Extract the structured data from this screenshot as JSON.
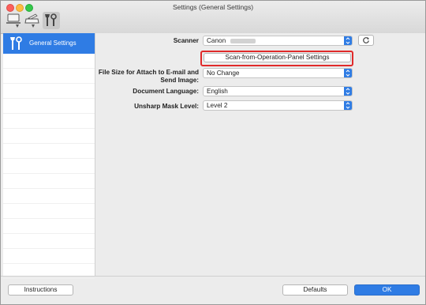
{
  "window": {
    "title": "Settings (General Settings)"
  },
  "toolbar": {
    "items": [
      {
        "icon": "computer-scan-icon"
      },
      {
        "icon": "scanner-scan-icon"
      },
      {
        "icon": "general-settings-icon"
      }
    ]
  },
  "sidebar": {
    "items": [
      {
        "label": "General Settings",
        "icon": "tools-icon"
      }
    ]
  },
  "form": {
    "scanner": {
      "label": "Scanner",
      "value": "Canon"
    },
    "operation_panel_button": "Scan-from-Operation-Panel Settings",
    "file_size": {
      "label_line1": "File Size for Attach to E-mail and",
      "label_line2": "Send Image:",
      "value": "No Change"
    },
    "document_language": {
      "label": "Document Language:",
      "value": "English"
    },
    "unsharp_mask": {
      "label": "Unsharp Mask Level:",
      "value": "Level 2"
    }
  },
  "footer": {
    "instructions": "Instructions",
    "defaults": "Defaults",
    "ok": "OK"
  },
  "colors": {
    "accent": "#2f7ce4",
    "highlight": "#e02a2a"
  }
}
